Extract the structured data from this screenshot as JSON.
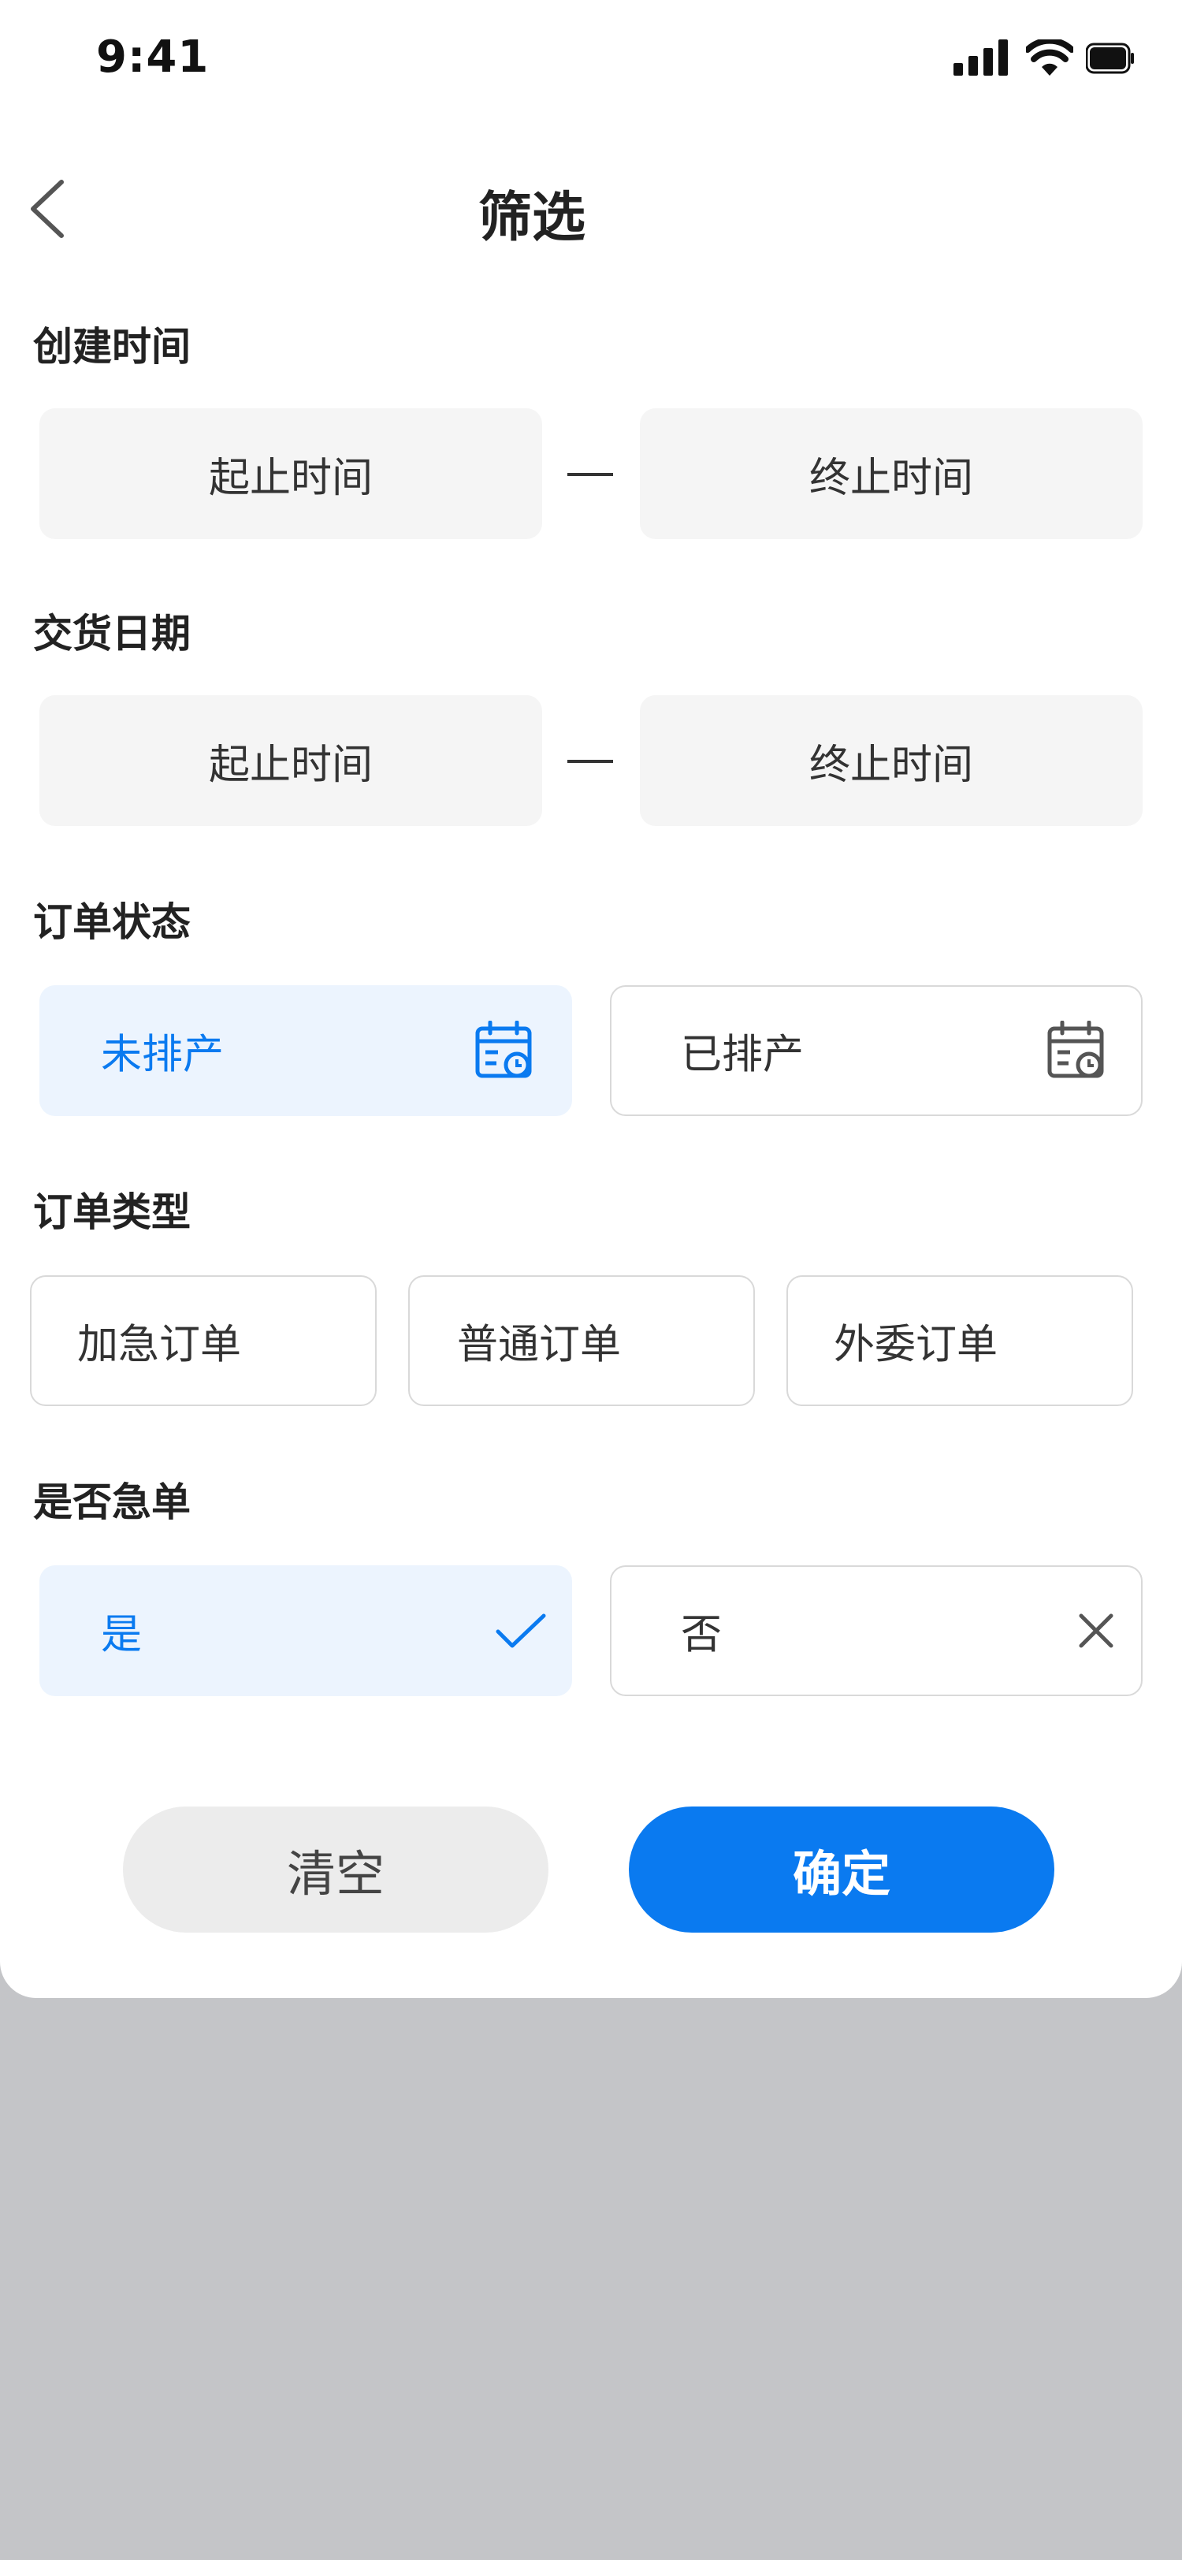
{
  "status_bar": {
    "time": "9:41"
  },
  "nav": {
    "title": "筛选"
  },
  "created_time": {
    "title": "创建时间",
    "start_placeholder": "起止时间",
    "end_placeholder": "终止时间"
  },
  "delivery_date": {
    "title": "交货日期",
    "start_placeholder": "起止时间",
    "end_placeholder": "终止时间"
  },
  "order_status": {
    "title": "订单状态",
    "options": [
      {
        "label": "未排产",
        "selected": true,
        "icon": "calendar-clock-icon"
      },
      {
        "label": "已排产",
        "selected": false,
        "icon": "calendar-clock-icon"
      }
    ]
  },
  "order_type": {
    "title": "订单类型",
    "options": [
      {
        "label": "加急订单",
        "selected": false
      },
      {
        "label": "普通订单",
        "selected": false
      },
      {
        "label": "外委订单",
        "selected": false
      }
    ]
  },
  "urgent": {
    "title": "是否急单",
    "options": [
      {
        "label": "是",
        "selected": true,
        "icon": "check-icon"
      },
      {
        "label": "否",
        "selected": false,
        "icon": "close-icon"
      }
    ]
  },
  "actions": {
    "clear_label": "清空",
    "confirm_label": "确定"
  },
  "colors": {
    "accent": "#0a7af0",
    "selected_bg": "#ecf4fe",
    "field_bg": "#f5f5f5",
    "backdrop": "#c4c5c8"
  }
}
